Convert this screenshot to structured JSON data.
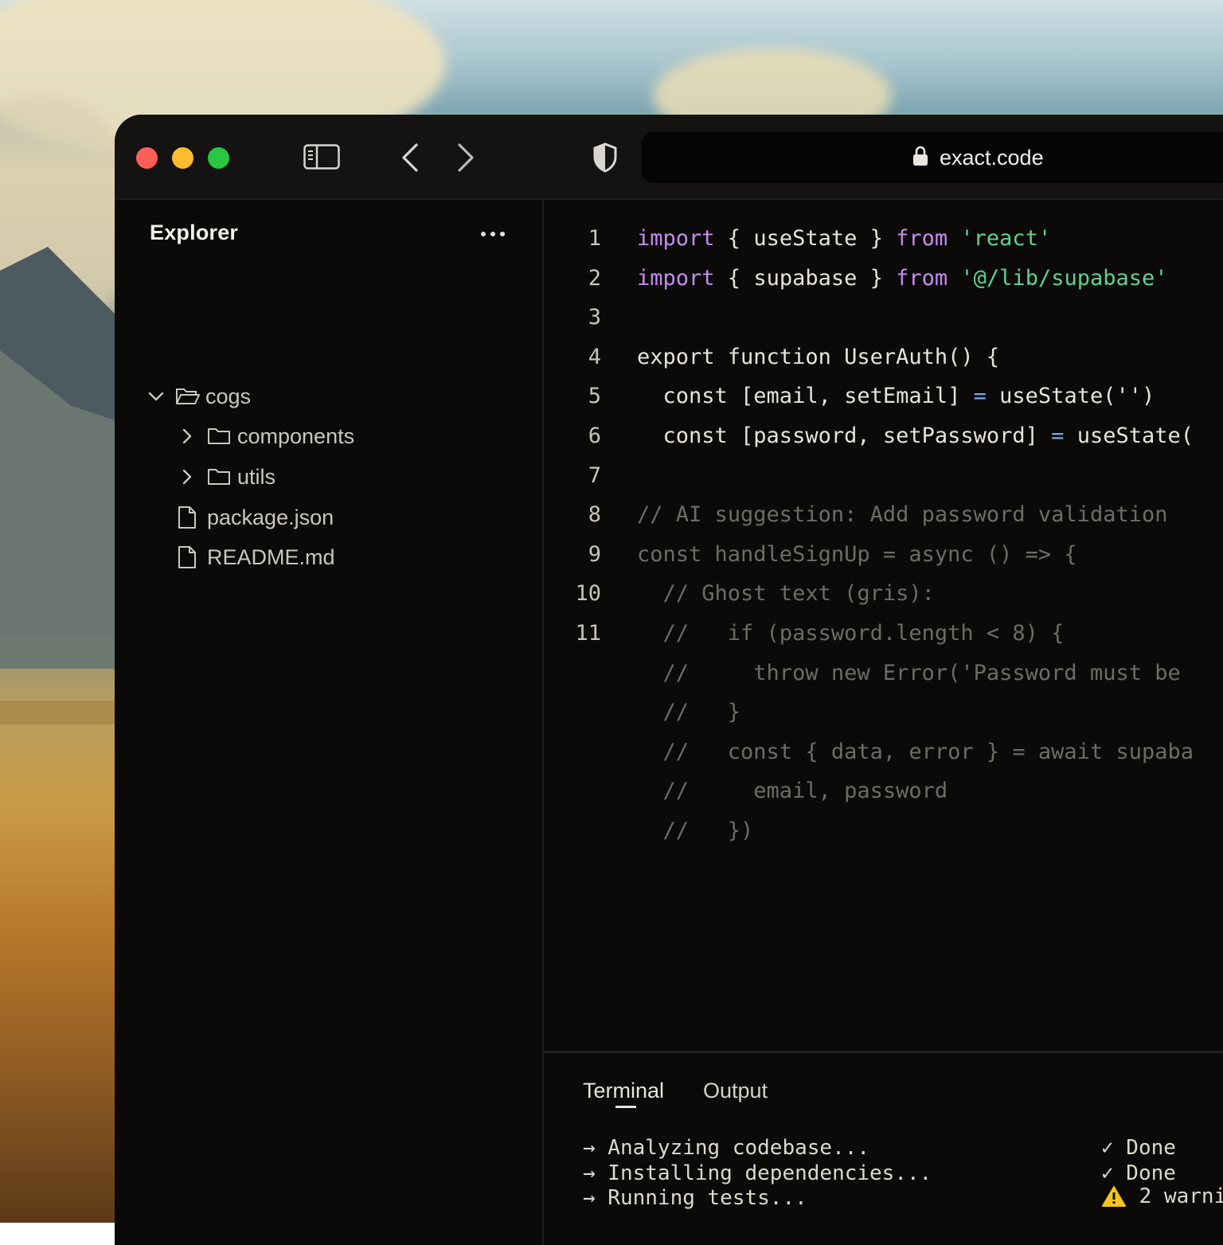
{
  "window": {
    "url": "exact.code"
  },
  "explorer": {
    "title": "Explorer",
    "tree": [
      {
        "label": "cogs",
        "kind": "folder",
        "expanded": true,
        "icon": "folder-open-icon"
      },
      {
        "label": "components",
        "kind": "folder",
        "expanded": false,
        "icon": "folder-icon"
      },
      {
        "label": "utils",
        "kind": "folder",
        "expanded": false,
        "icon": "folder-icon"
      },
      {
        "label": "package.json",
        "kind": "file",
        "icon": "file-icon"
      },
      {
        "label": "README.md",
        "kind": "file",
        "icon": "file-icon"
      }
    ]
  },
  "editor": {
    "line_numbers": [
      "1",
      "2",
      "3",
      "4",
      "5",
      "6",
      "7",
      "8",
      "9",
      "10",
      "11"
    ],
    "lines": [
      {
        "import": "import",
        "mid": " { useState } ",
        "from": "from",
        "str": " 'react'"
      },
      {
        "import": "import",
        "mid": " { supabase } ",
        "from": "from",
        "str": " '@/lib/supabase'"
      },
      {},
      {
        "text": "export function UserAuth() {"
      },
      {
        "a": "  const [email, setEmail] ",
        "eq": "=",
        "b": " useState('')"
      },
      {
        "a": "  const [password, setPassword] ",
        "eq": "=",
        "b": " useState("
      },
      {},
      {
        "ghost": "// AI suggestion: Add password validation"
      },
      {
        "ghost": "const handleSignUp = async () => {"
      },
      {
        "ghost": "  // Ghost text (gris):"
      },
      {
        "ghost": "  //   if (password.length < 8) {"
      },
      {
        "ghost": "  //     throw new Error('Password must be"
      },
      {
        "ghost": "  //   }"
      },
      {
        "ghost": "  //   const { data, error } = await supaba"
      },
      {
        "ghost": "  //     email, password"
      },
      {
        "ghost": "  //   })"
      }
    ]
  },
  "panel": {
    "tabs": [
      {
        "label": "Terminal",
        "active": true
      },
      {
        "label": "Output",
        "active": false
      }
    ],
    "terminal": [
      {
        "text": "→ Analyzing codebase...",
        "status": "✓ Done"
      },
      {
        "text": "→ Installing dependencies...",
        "status": "✓ Done"
      },
      {
        "text": "→ Running tests...",
        "status": " 2 warni"
      }
    ]
  },
  "colors": {
    "keyword": "#c58cf0",
    "string": "#5fd38f",
    "operator": "#6fa8ff",
    "ghost": "#6f6b64",
    "close": "#fe5f57",
    "minimize": "#febc2e",
    "zoom": "#28c840",
    "warning": "#f5c518"
  }
}
